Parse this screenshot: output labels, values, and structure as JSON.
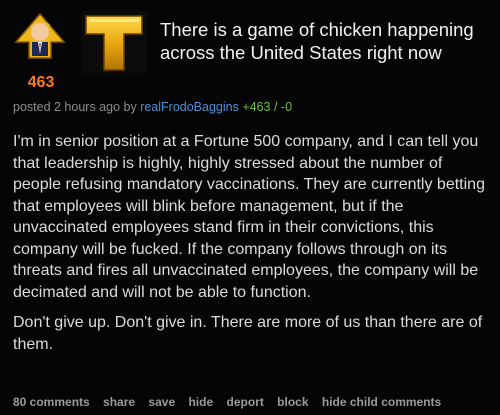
{
  "post": {
    "score": "463",
    "thumbnail_letter": "T",
    "title": "There is a game of chicken happening across the United States right now",
    "meta": {
      "posted_prefix": "posted 2 hours ago by ",
      "author": "realFrodoBaggins",
      "points": "+463 / -0"
    },
    "body": [
      "I'm in senior position at a Fortune 500 company, and I can tell you that leadership is highly, highly stressed about the number of people refusing mandatory vaccinations. They are currently betting that employees will blink before management, but if the unvaccinated employees stand firm in their convictions, this company will be fucked. If the company follows through on its threats and fires all unvaccinated employees, the company will be decimated and will not be able to function.",
      "Don't give up. Don't give in. There are more of us than there are of them."
    ],
    "actions": [
      "80 comments",
      "share",
      "save",
      "hide",
      "deport",
      "block",
      "hide child comments"
    ]
  },
  "colors": {
    "background": "#050505",
    "score": "#ff7a1a",
    "author": "#4f8fd9",
    "points": "#6fbf3c",
    "upvote_gold": "#f0b51c"
  },
  "icons": {
    "upvote": "upvote-arrow-icon",
    "thumbnail": "gold-letter-t-icon"
  }
}
